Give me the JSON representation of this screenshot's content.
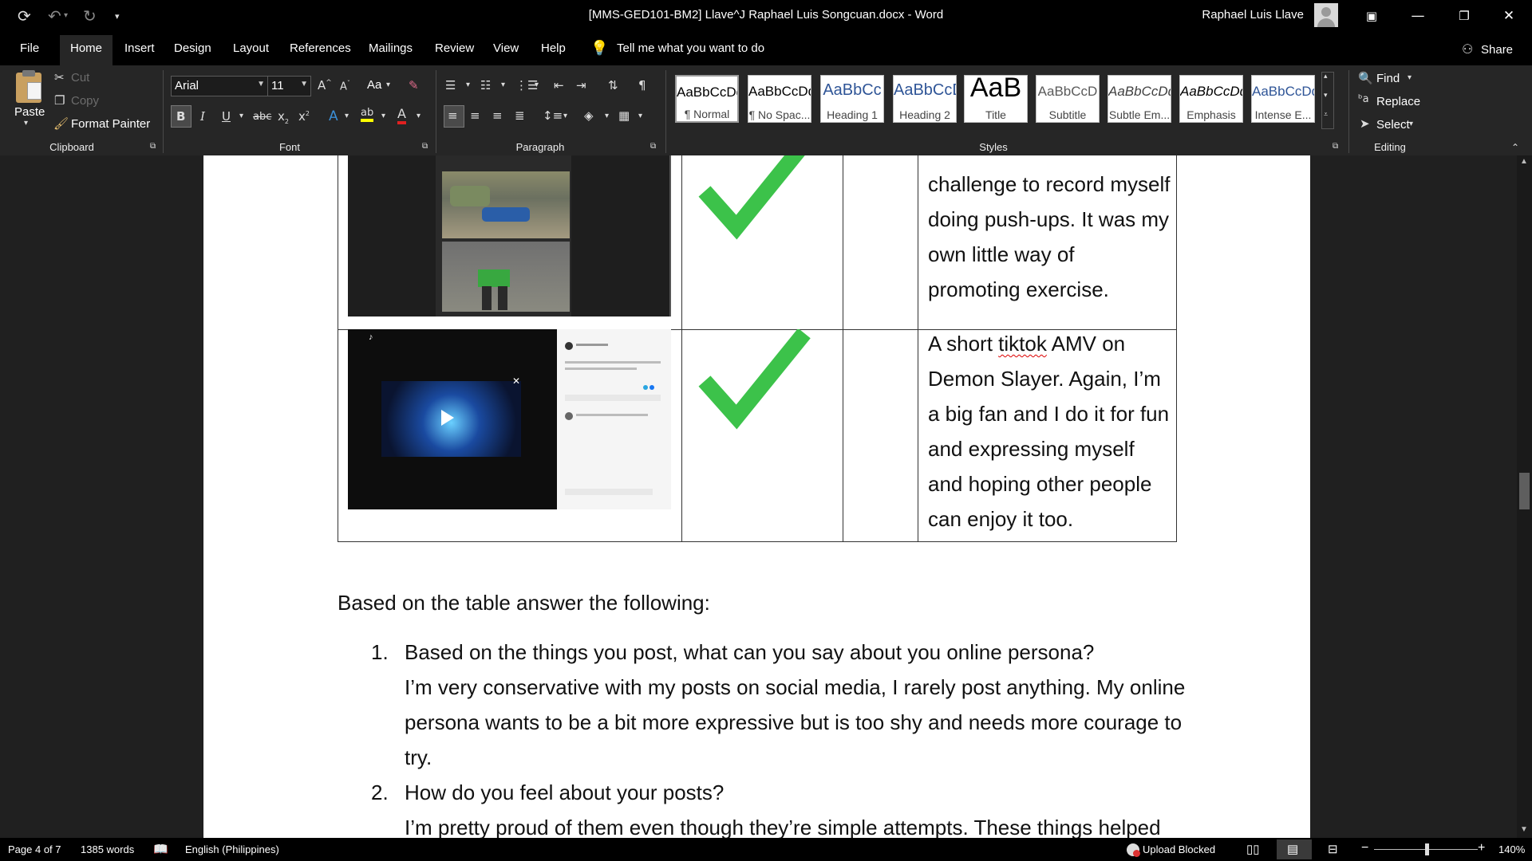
{
  "title_bar": {
    "document_title": "[MMS-GED101-BM2] Llave^J Raphael Luis Songcuan.docx  -  Word",
    "user_name": "Raphael Luis Llave",
    "quick_access": [
      "autosave-icon",
      "undo-icon",
      "redo-icon",
      "customize-icon"
    ]
  },
  "tabs": [
    "File",
    "Home",
    "Insert",
    "Design",
    "Layout",
    "References",
    "Mailings",
    "Review",
    "View",
    "Help"
  ],
  "active_tab": "Home",
  "tell_me": "Tell me what you want to do",
  "share": "Share",
  "clipboard": {
    "paste": "Paste",
    "cut": "Cut",
    "copy": "Copy",
    "format_painter": "Format Painter",
    "label": "Clipboard"
  },
  "font": {
    "name": "Arial",
    "size": "11",
    "label": "Font",
    "change_case": "Aa"
  },
  "paragraph": {
    "label": "Paragraph"
  },
  "styles": {
    "label": "Styles",
    "items": [
      {
        "sample": "AaBbCcDd",
        "name": "¶ Normal",
        "color": "#000000"
      },
      {
        "sample": "AaBbCcDd",
        "name": "¶ No Spac...",
        "color": "#000000"
      },
      {
        "sample": "AaBbCc",
        "name": "Heading 1",
        "color": "#2f5597"
      },
      {
        "sample": "AaBbCcD",
        "name": "Heading 2",
        "color": "#2f5597"
      },
      {
        "sample": "AaB",
        "name": "Title",
        "color": "#000000"
      },
      {
        "sample": "AaBbCcD",
        "name": "Subtitle",
        "color": "#5a5a5a"
      },
      {
        "sample": "AaBbCcDd",
        "name": "Subtle Em...",
        "color": "#404040"
      },
      {
        "sample": "AaBbCcDd",
        "name": "Emphasis",
        "color": "#000000"
      },
      {
        "sample": "AaBbCcDd",
        "name": "Intense E...",
        "color": "#2f5597"
      }
    ]
  },
  "editing": {
    "find": "Find",
    "replace": "Replace",
    "select": "Select",
    "label": "Editing"
  },
  "document": {
    "row1_text": [
      "challenge to record myself",
      "doing push-ups. It was my",
      "own little way of",
      "promoting exercise."
    ],
    "row2_text_a": "A short ",
    "row2_text_squiggle": "tiktok",
    "row2_text_b": " AMV on",
    "row2_text": [
      "Demon Slayer. Again, I’m",
      "a big fan and I do it for fun",
      "and expressing myself",
      "and hoping other people",
      "can enjoy it too."
    ],
    "prompt": "Based on the table answer the following:",
    "questions": [
      {
        "number": "1.",
        "question": "Based on the things you post, what can you say about you online persona?",
        "answer": [
          "I’m very conservative with my posts on social media, I rarely post anything. My online",
          "persona wants to be a bit more expressive but is too shy and needs more courage to",
          "try."
        ]
      },
      {
        "number": "2.",
        "question": "How do you feel about your posts?",
        "answer": [
          "I’m pretty proud of them even though they’re simple attempts. These things helped"
        ]
      }
    ]
  },
  "status": {
    "page": "Page 4 of 7",
    "words": "1385 words",
    "language": "English (Philippines)",
    "upload": "Upload Blocked",
    "zoom": "140%"
  },
  "colors": {
    "check": "#3cc24a",
    "ribbon": "#262626",
    "titlebar": "#000000"
  }
}
